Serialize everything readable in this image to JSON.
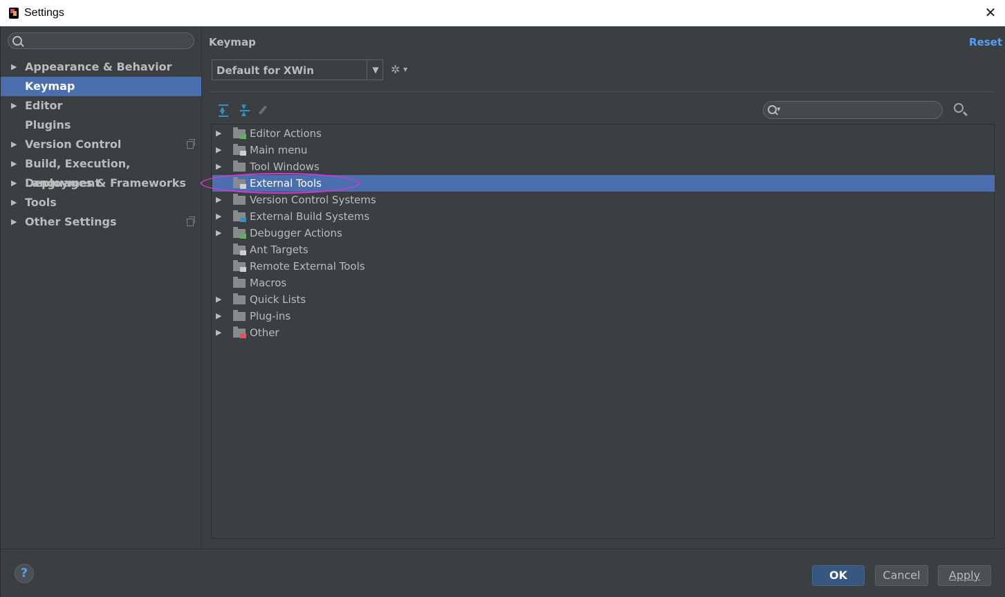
{
  "window": {
    "title": "Settings",
    "close_glyph": "✕",
    "app_icon": "intellij-icon"
  },
  "sidebar": {
    "search_placeholder": "",
    "items": [
      {
        "label": "Appearance & Behavior",
        "expandable": true,
        "selected": false,
        "copy_icon": false
      },
      {
        "label": "Keymap",
        "expandable": false,
        "selected": true,
        "copy_icon": false
      },
      {
        "label": "Editor",
        "expandable": true,
        "selected": false,
        "copy_icon": false
      },
      {
        "label": "Plugins",
        "expandable": false,
        "selected": false,
        "copy_icon": false
      },
      {
        "label": "Version Control",
        "expandable": true,
        "selected": false,
        "copy_icon": true
      },
      {
        "label": "Build, Execution, Deployment",
        "expandable": true,
        "selected": false,
        "copy_icon": false
      },
      {
        "label": "Languages & Frameworks",
        "expandable": true,
        "selected": false,
        "copy_icon": false
      },
      {
        "label": "Tools",
        "expandable": true,
        "selected": false,
        "copy_icon": false
      },
      {
        "label": "Other Settings",
        "expandable": true,
        "selected": false,
        "copy_icon": true
      }
    ]
  },
  "main": {
    "title": "Keymap",
    "reset_label": "Reset",
    "keymap_value": "Default for XWin",
    "dropdown_glyph": "▼",
    "gear_glyph": "✲",
    "search_placeholder": "",
    "tree": [
      {
        "label": "Editor Actions",
        "expandable": true,
        "selected": false,
        "icon": "editor-actions-icon",
        "badge": "#5fb05f"
      },
      {
        "label": "Main menu",
        "expandable": true,
        "selected": false,
        "icon": "main-menu-icon",
        "badge": "#cfcfcf"
      },
      {
        "label": "Tool Windows",
        "expandable": true,
        "selected": false,
        "icon": "folder-icon",
        "badge": ""
      },
      {
        "label": "External Tools",
        "expandable": false,
        "selected": true,
        "icon": "external-tools-icon",
        "badge": "#cfcfcf"
      },
      {
        "label": "Version Control Systems",
        "expandable": true,
        "selected": false,
        "icon": "folder-icon",
        "badge": ""
      },
      {
        "label": "External Build Systems",
        "expandable": true,
        "selected": false,
        "icon": "external-build-icon",
        "badge": "#3592c4"
      },
      {
        "label": "Debugger Actions",
        "expandable": true,
        "selected": false,
        "icon": "debugger-bug-icon",
        "badge": "#5fb05f"
      },
      {
        "label": "Ant Targets",
        "expandable": false,
        "selected": false,
        "icon": "ant-targets-icon",
        "badge": "#cfcfcf"
      },
      {
        "label": "Remote External Tools",
        "expandable": false,
        "selected": false,
        "icon": "remote-tools-icon",
        "badge": "#cfcfcf"
      },
      {
        "label": "Macros",
        "expandable": false,
        "selected": false,
        "icon": "folder-icon",
        "badge": ""
      },
      {
        "label": "Quick Lists",
        "expandable": true,
        "selected": false,
        "icon": "folder-icon",
        "badge": ""
      },
      {
        "label": "Plug-ins",
        "expandable": true,
        "selected": false,
        "icon": "folder-icon",
        "badge": ""
      },
      {
        "label": "Other",
        "expandable": true,
        "selected": false,
        "icon": "other-icon",
        "badge": "#e05555"
      }
    ]
  },
  "footer": {
    "help_label": "?",
    "ok_label": "OK",
    "cancel_label": "Cancel",
    "apply_label": "Apply"
  },
  "colors": {
    "accent": "#4b6eaf",
    "link": "#589df6",
    "highlight_oval": "#d438d4",
    "background": "#3c3f41"
  }
}
